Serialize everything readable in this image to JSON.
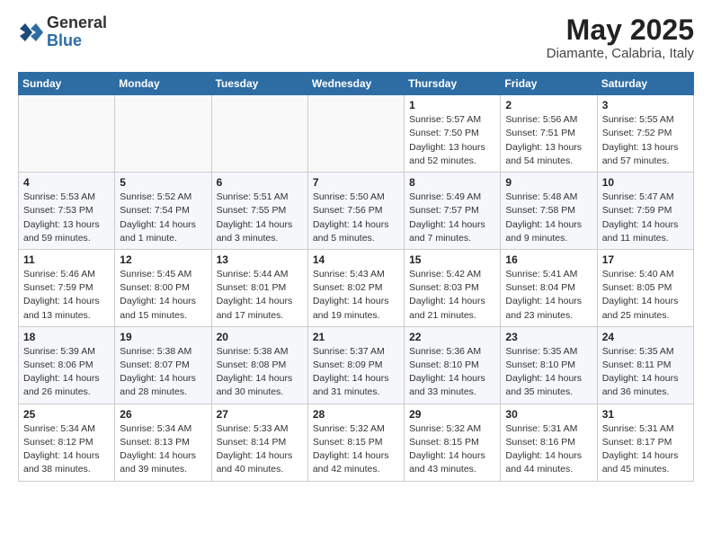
{
  "header": {
    "logo_general": "General",
    "logo_blue": "Blue",
    "title": "May 2025",
    "subtitle": "Diamante, Calabria, Italy"
  },
  "days_of_week": [
    "Sunday",
    "Monday",
    "Tuesday",
    "Wednesday",
    "Thursday",
    "Friday",
    "Saturday"
  ],
  "weeks": [
    [
      {
        "day": "",
        "info": ""
      },
      {
        "day": "",
        "info": ""
      },
      {
        "day": "",
        "info": ""
      },
      {
        "day": "",
        "info": ""
      },
      {
        "day": "1",
        "info": "Sunrise: 5:57 AM\nSunset: 7:50 PM\nDaylight: 13 hours\nand 52 minutes."
      },
      {
        "day": "2",
        "info": "Sunrise: 5:56 AM\nSunset: 7:51 PM\nDaylight: 13 hours\nand 54 minutes."
      },
      {
        "day": "3",
        "info": "Sunrise: 5:55 AM\nSunset: 7:52 PM\nDaylight: 13 hours\nand 57 minutes."
      }
    ],
    [
      {
        "day": "4",
        "info": "Sunrise: 5:53 AM\nSunset: 7:53 PM\nDaylight: 13 hours\nand 59 minutes."
      },
      {
        "day": "5",
        "info": "Sunrise: 5:52 AM\nSunset: 7:54 PM\nDaylight: 14 hours\nand 1 minute."
      },
      {
        "day": "6",
        "info": "Sunrise: 5:51 AM\nSunset: 7:55 PM\nDaylight: 14 hours\nand 3 minutes."
      },
      {
        "day": "7",
        "info": "Sunrise: 5:50 AM\nSunset: 7:56 PM\nDaylight: 14 hours\nand 5 minutes."
      },
      {
        "day": "8",
        "info": "Sunrise: 5:49 AM\nSunset: 7:57 PM\nDaylight: 14 hours\nand 7 minutes."
      },
      {
        "day": "9",
        "info": "Sunrise: 5:48 AM\nSunset: 7:58 PM\nDaylight: 14 hours\nand 9 minutes."
      },
      {
        "day": "10",
        "info": "Sunrise: 5:47 AM\nSunset: 7:59 PM\nDaylight: 14 hours\nand 11 minutes."
      }
    ],
    [
      {
        "day": "11",
        "info": "Sunrise: 5:46 AM\nSunset: 7:59 PM\nDaylight: 14 hours\nand 13 minutes."
      },
      {
        "day": "12",
        "info": "Sunrise: 5:45 AM\nSunset: 8:00 PM\nDaylight: 14 hours\nand 15 minutes."
      },
      {
        "day": "13",
        "info": "Sunrise: 5:44 AM\nSunset: 8:01 PM\nDaylight: 14 hours\nand 17 minutes."
      },
      {
        "day": "14",
        "info": "Sunrise: 5:43 AM\nSunset: 8:02 PM\nDaylight: 14 hours\nand 19 minutes."
      },
      {
        "day": "15",
        "info": "Sunrise: 5:42 AM\nSunset: 8:03 PM\nDaylight: 14 hours\nand 21 minutes."
      },
      {
        "day": "16",
        "info": "Sunrise: 5:41 AM\nSunset: 8:04 PM\nDaylight: 14 hours\nand 23 minutes."
      },
      {
        "day": "17",
        "info": "Sunrise: 5:40 AM\nSunset: 8:05 PM\nDaylight: 14 hours\nand 25 minutes."
      }
    ],
    [
      {
        "day": "18",
        "info": "Sunrise: 5:39 AM\nSunset: 8:06 PM\nDaylight: 14 hours\nand 26 minutes."
      },
      {
        "day": "19",
        "info": "Sunrise: 5:38 AM\nSunset: 8:07 PM\nDaylight: 14 hours\nand 28 minutes."
      },
      {
        "day": "20",
        "info": "Sunrise: 5:38 AM\nSunset: 8:08 PM\nDaylight: 14 hours\nand 30 minutes."
      },
      {
        "day": "21",
        "info": "Sunrise: 5:37 AM\nSunset: 8:09 PM\nDaylight: 14 hours\nand 31 minutes."
      },
      {
        "day": "22",
        "info": "Sunrise: 5:36 AM\nSunset: 8:10 PM\nDaylight: 14 hours\nand 33 minutes."
      },
      {
        "day": "23",
        "info": "Sunrise: 5:35 AM\nSunset: 8:10 PM\nDaylight: 14 hours\nand 35 minutes."
      },
      {
        "day": "24",
        "info": "Sunrise: 5:35 AM\nSunset: 8:11 PM\nDaylight: 14 hours\nand 36 minutes."
      }
    ],
    [
      {
        "day": "25",
        "info": "Sunrise: 5:34 AM\nSunset: 8:12 PM\nDaylight: 14 hours\nand 38 minutes."
      },
      {
        "day": "26",
        "info": "Sunrise: 5:34 AM\nSunset: 8:13 PM\nDaylight: 14 hours\nand 39 minutes."
      },
      {
        "day": "27",
        "info": "Sunrise: 5:33 AM\nSunset: 8:14 PM\nDaylight: 14 hours\nand 40 minutes."
      },
      {
        "day": "28",
        "info": "Sunrise: 5:32 AM\nSunset: 8:15 PM\nDaylight: 14 hours\nand 42 minutes."
      },
      {
        "day": "29",
        "info": "Sunrise: 5:32 AM\nSunset: 8:15 PM\nDaylight: 14 hours\nand 43 minutes."
      },
      {
        "day": "30",
        "info": "Sunrise: 5:31 AM\nSunset: 8:16 PM\nDaylight: 14 hours\nand 44 minutes."
      },
      {
        "day": "31",
        "info": "Sunrise: 5:31 AM\nSunset: 8:17 PM\nDaylight: 14 hours\nand 45 minutes."
      }
    ]
  ]
}
